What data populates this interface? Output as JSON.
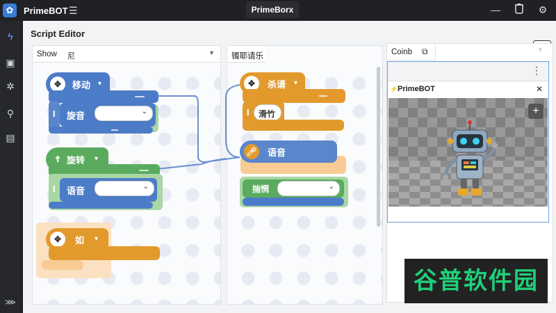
{
  "app": {
    "name": "PrimeBOT",
    "center_tab": "PrimeBorx",
    "accent": "#3b7bd6"
  },
  "panel": {
    "title": "Script Editor"
  },
  "columns": {
    "left_label": "Show",
    "left_label_icon": "尼",
    "mid_label": "镯耶请乐",
    "right_label": "Coinb"
  },
  "blocks_left": {
    "move_label": "移动",
    "spin_label": "旋音",
    "rotate_label": "旋转",
    "voice_label": "语音",
    "if_label": "如"
  },
  "blocks_mid": {
    "kill_label": "杀请",
    "slide_label": "滑竹",
    "speech_label": "语音",
    "ask_label": "揣惘"
  },
  "preview": {
    "title": "PrimeBOT"
  },
  "watermark": "谷普软件园",
  "colors": {
    "blue": "#4c7cc8",
    "green": "#5aab5e",
    "orange": "#e39a2d"
  }
}
